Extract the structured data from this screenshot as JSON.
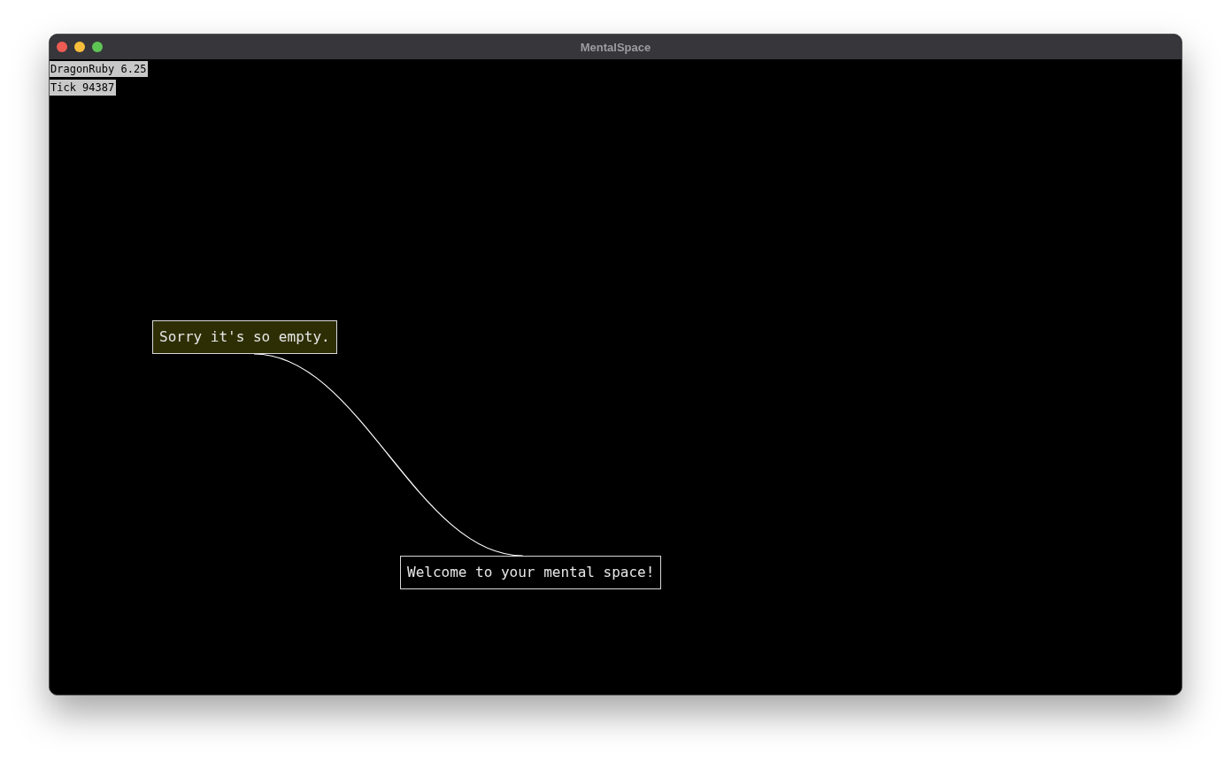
{
  "window": {
    "title": "MentalSpace"
  },
  "debug_lines": [
    "DragonRuby 6.25",
    "Tick 94387"
  ],
  "nodes": [
    {
      "text": "Sorry it's so empty.",
      "color": "#2e2e05"
    },
    {
      "text": "Welcome to your mental space!",
      "color": "#000000"
    }
  ]
}
